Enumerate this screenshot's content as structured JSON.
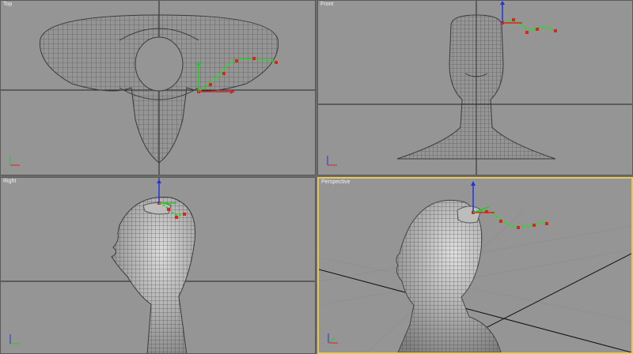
{
  "viewports": {
    "top": {
      "label": "Top"
    },
    "front": {
      "label": "Front"
    },
    "right": {
      "label": "Right"
    },
    "perspective": {
      "label": "Perspective"
    }
  },
  "colors": {
    "viewport_bg": "#959595",
    "active_border": "#e6c85a",
    "wire": "#4a4a4a",
    "spline": "#22dd22",
    "vertex": "#dd2222",
    "axis_x": "#dd2222",
    "axis_y": "#22cc22",
    "axis_z": "#2233dd"
  },
  "icons": {
    "transform_gizmo": "move-gizmo-icon",
    "axis_tripod": "axis-tripod-icon"
  }
}
